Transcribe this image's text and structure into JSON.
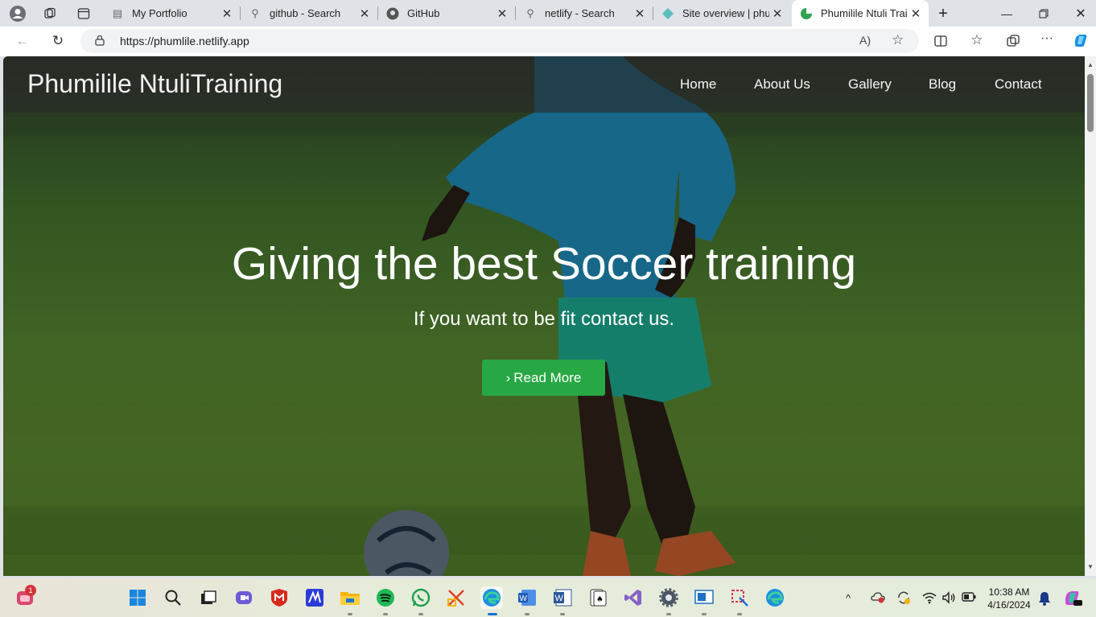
{
  "browser": {
    "tabs": [
      {
        "label": "My Portfolio",
        "icon": "document-icon"
      },
      {
        "label": "github - Search",
        "icon": "search-icon"
      },
      {
        "label": "GitHub",
        "icon": "github-icon"
      },
      {
        "label": "netlify - Search",
        "icon": "search-icon"
      },
      {
        "label": "Site overview | phun",
        "icon": "netlify-icon"
      },
      {
        "label": "Phumilile Ntuli Train",
        "icon": "site-favicon",
        "active": true
      }
    ],
    "url": "https://phumlile.netlify.app"
  },
  "site": {
    "brand": "Phumilile NtuliTraining",
    "nav": [
      "Home",
      "About Us",
      "Gallery",
      "Blog",
      "Contact"
    ],
    "hero": {
      "title": "Giving the best Soccer training",
      "subtitle": "If you want to be fit contact us.",
      "button": "Read More"
    },
    "accent": "#28a745"
  },
  "taskbar": {
    "notification_count": "1",
    "time": "10:38 AM",
    "date": "4/16/2024"
  }
}
